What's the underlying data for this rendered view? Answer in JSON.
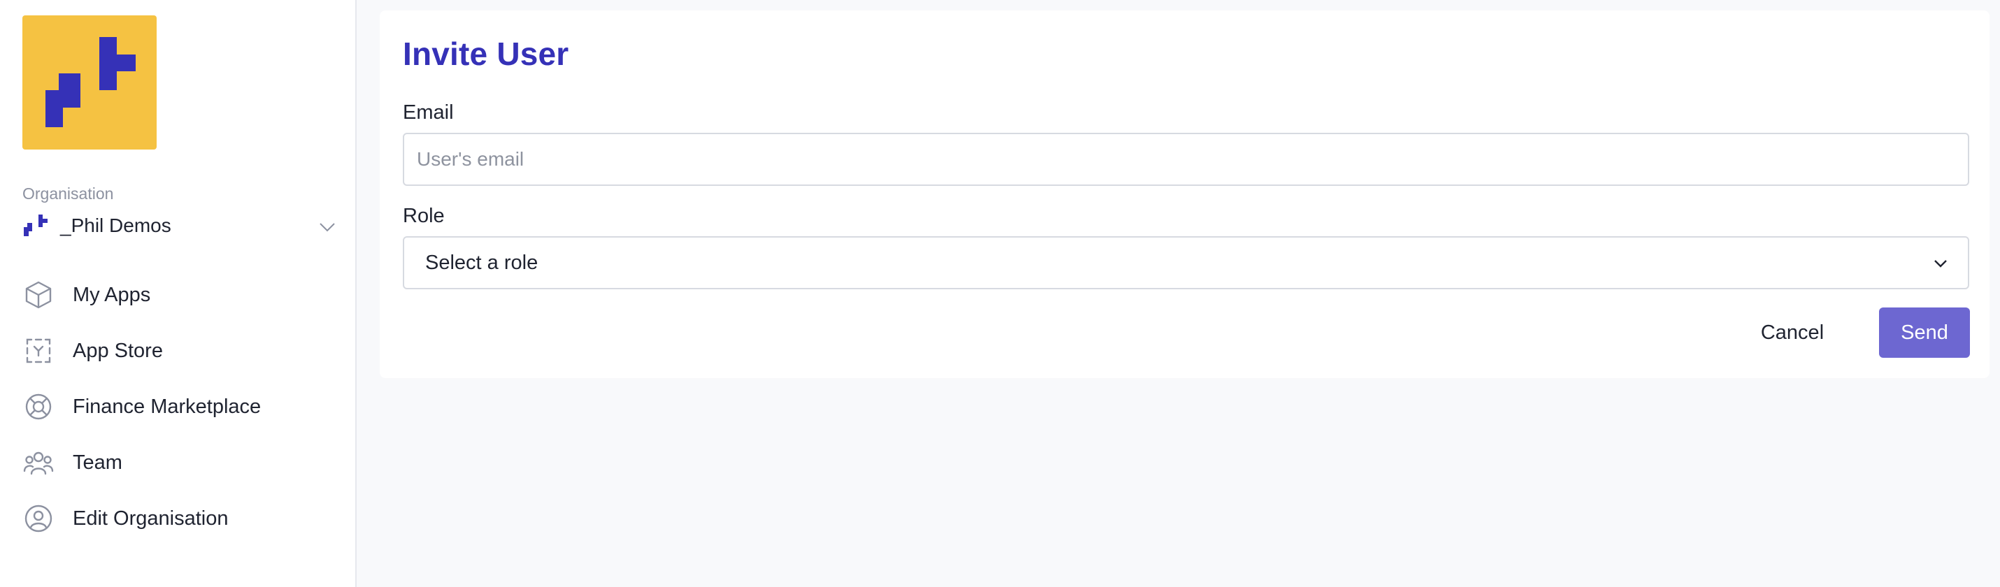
{
  "sidebar": {
    "logo_icon": "brand-logo",
    "organisation_label": "Organisation",
    "organisation_name": "_Phil Demos",
    "items": [
      {
        "label": "My Apps",
        "icon": "cube-icon"
      },
      {
        "label": "App Store",
        "icon": "app-store-icon"
      },
      {
        "label": "Finance Marketplace",
        "icon": "lifebuoy-icon"
      },
      {
        "label": "Team",
        "icon": "team-icon"
      },
      {
        "label": "Edit Organisation",
        "icon": "user-circle-icon"
      }
    ]
  },
  "form": {
    "title": "Invite User",
    "email_label": "Email",
    "email_placeholder": "User's email",
    "email_value": "",
    "role_label": "Role",
    "role_value": "Select a role",
    "cancel_label": "Cancel",
    "send_label": "Send"
  },
  "colors": {
    "brand_yellow": "#f5c242",
    "brand_blue": "#3531b7",
    "send_button": "#6d67d1",
    "page_background": "#f8f9fb"
  }
}
